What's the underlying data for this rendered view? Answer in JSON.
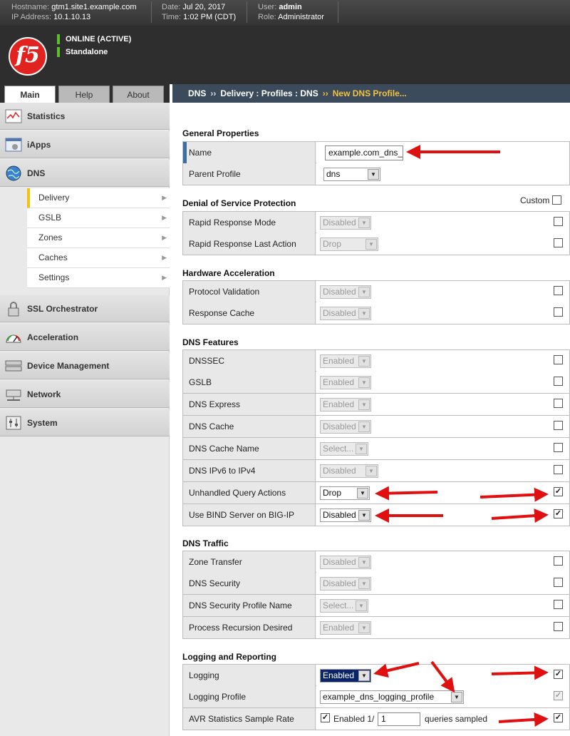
{
  "topbar": {
    "hostname_label": "Hostname:",
    "hostname": "gtm1.site1.example.com",
    "ip_label": "IP Address:",
    "ip": "10.1.10.13",
    "date_label": "Date:",
    "date": "Jul 20, 2017",
    "time_label": "Time:",
    "time": "1:02 PM (CDT)",
    "user_label": "User:",
    "user": "admin",
    "role_label": "Role:",
    "role": "Administrator"
  },
  "header": {
    "logo": "f5",
    "status": "ONLINE (ACTIVE)",
    "mode": "Standalone",
    "status_color": "#5cbf2a"
  },
  "tabs": {
    "main": "Main",
    "help": "Help",
    "about": "About"
  },
  "breadcrumb": {
    "a": "DNS",
    "b": "Delivery : Profiles : DNS",
    "c": "New DNS Profile...",
    "sep": "››"
  },
  "sidebar": {
    "statistics": "Statistics",
    "iapps": "iApps",
    "dns": "DNS",
    "sub": [
      "Delivery",
      "GSLB",
      "Zones",
      "Caches",
      "Settings"
    ],
    "ssl": "SSL Orchestrator",
    "acceleration": "Acceleration",
    "device": "Device Management",
    "network": "Network",
    "system": "System"
  },
  "sections": {
    "general": "General Properties",
    "dos": "Denial of Service Protection",
    "hw": "Hardware Acceleration",
    "features": "DNS Features",
    "traffic": "DNS Traffic",
    "logging": "Logging and Reporting",
    "custom": "Custom"
  },
  "fields": {
    "name_label": "Name",
    "name_value": "example.com_dns_",
    "parent_label": "Parent Profile",
    "parent_value": "dns",
    "rrm_label": "Rapid Response Mode",
    "rrm_value": "Disabled",
    "rrla_label": "Rapid Response Last Action",
    "rrla_value": "Drop",
    "pv_label": "Protocol Validation",
    "pv_value": "Disabled",
    "rc_label": "Response Cache",
    "rc_value": "Disabled",
    "dnssec_label": "DNSSEC",
    "dnssec_value": "Enabled",
    "gslb_label": "GSLB",
    "gslb_value": "Enabled",
    "express_label": "DNS Express",
    "express_value": "Enabled",
    "cache_label": "DNS Cache",
    "cache_value": "Disabled",
    "cachename_label": "DNS Cache Name",
    "cachename_value": "Select...",
    "ipv6_label": "DNS IPv6 to IPv4",
    "ipv6_value": "Disabled",
    "uqa_label": "Unhandled Query Actions",
    "uqa_value": "Drop",
    "bind_label": "Use BIND Server on BIG-IP",
    "bind_value": "Disabled",
    "zt_label": "Zone Transfer",
    "zt_value": "Disabled",
    "sec_label": "DNS Security",
    "sec_value": "Disabled",
    "secname_label": "DNS Security Profile Name",
    "secname_value": "Select...",
    "prd_label": "Process Recursion Desired",
    "prd_value": "Enabled",
    "log_label": "Logging",
    "log_value": "Enabled",
    "logprof_label": "Logging Profile",
    "logprof_value": "example_dns_logging_profile",
    "avr_label": "AVR Statistics Sample Rate",
    "avr_enabled": "Enabled 1/",
    "avr_rate": "1",
    "avr_suffix": "queries sampled"
  },
  "checkbox_mark": "✓",
  "arrow_glyph": "▼",
  "annotation_color": "#e01010"
}
